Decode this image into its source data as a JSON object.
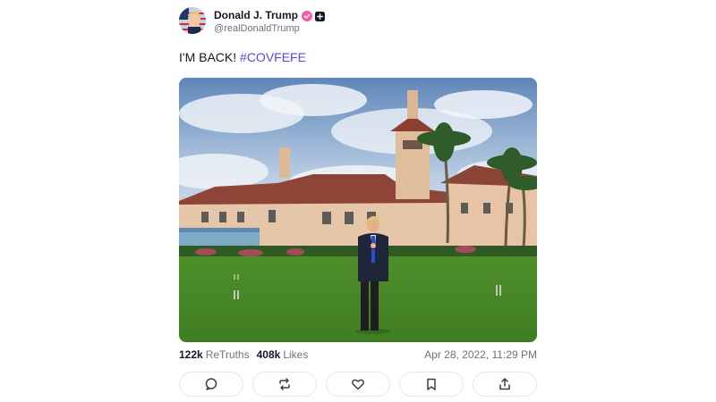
{
  "author": {
    "display_name": "Donald J. Trump",
    "handle": "@realDonaldTrump",
    "avatar": "avatar-image",
    "verified_color": "#ef5da8"
  },
  "post": {
    "text": "I'M BACK! ",
    "hashtag": "#COVFEFE",
    "hashtag_color": "#5448ee",
    "image": "photo-man-standing-on-lawn-in-front-of-mansion"
  },
  "stats": {
    "retruths_count": "122k",
    "retruths_label": "ReTruths",
    "likes_count": "408k",
    "likes_label": "Likes",
    "timestamp": "Apr 28, 2022, 11:29 PM"
  },
  "actions": [
    {
      "name": "reply",
      "icon": "comment-icon"
    },
    {
      "name": "retruth",
      "icon": "repost-icon"
    },
    {
      "name": "like",
      "icon": "heart-icon"
    },
    {
      "name": "bookmark",
      "icon": "bookmark-icon"
    },
    {
      "name": "share",
      "icon": "share-icon"
    }
  ]
}
